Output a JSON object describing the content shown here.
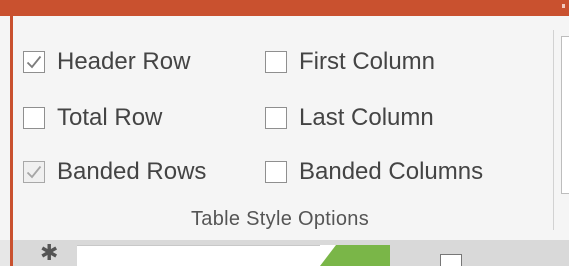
{
  "window": {
    "accent_color": "#c9512f"
  },
  "table_style_options": {
    "group_label": "Table Style Options",
    "options": [
      {
        "label": "Header Row",
        "checked": true,
        "enabled": true
      },
      {
        "label": "First Column",
        "checked": false,
        "enabled": true
      },
      {
        "label": "Total Row",
        "checked": false,
        "enabled": true
      },
      {
        "label": "Last Column",
        "checked": false,
        "enabled": true
      },
      {
        "label": "Banded Rows",
        "checked": true,
        "enabled": false
      },
      {
        "label": "Banded Columns",
        "checked": false,
        "enabled": true
      }
    ]
  },
  "bottom_strip": {
    "icon": "star-icon"
  }
}
